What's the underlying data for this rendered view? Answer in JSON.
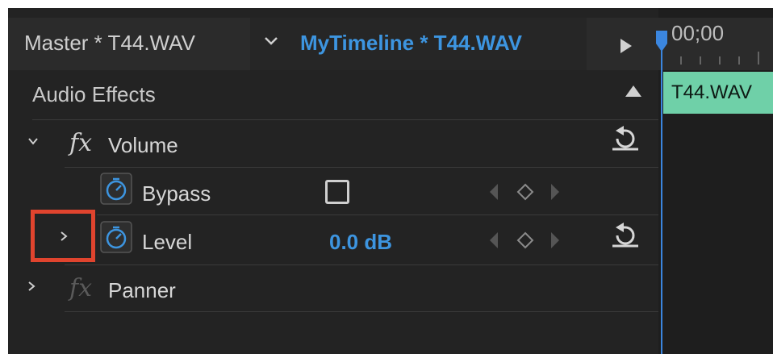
{
  "header": {
    "master_label": "Master * T44.WAV",
    "timeline_label": "MyTimeline * T44.WAV"
  },
  "section": {
    "title": "Audio Effects"
  },
  "effects": [
    {
      "fx": "fx",
      "name": "Volume",
      "expanded": true
    },
    {
      "fx": "fx",
      "name": "Panner",
      "expanded": false
    }
  ],
  "params": {
    "bypass": {
      "label": "Bypass",
      "checked": false
    },
    "level": {
      "label": "Level",
      "value": "0.0 dB"
    }
  },
  "timeline": {
    "timecode": "00;00",
    "clip_label": "T44.WAV"
  },
  "colors": {
    "accent_blue": "#3d95e0",
    "clip_green": "#6fd0a8",
    "highlight_red": "#e0442e"
  },
  "icons": {
    "stopwatch": "stopwatch-icon",
    "reset": "reset-icon",
    "keyframe": "keyframe-icon"
  }
}
